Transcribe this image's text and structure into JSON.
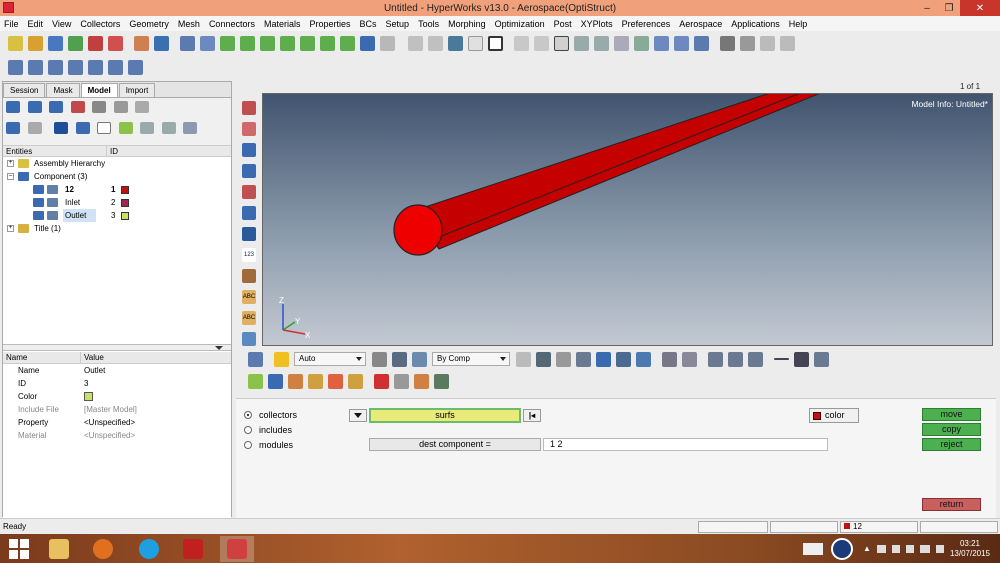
{
  "window": {
    "title": "Untitled - HyperWorks v13.0 - Aerospace(OptiStruct)",
    "minimize": "–",
    "restore": "❐",
    "close": "✕"
  },
  "menu": [
    "File",
    "Edit",
    "View",
    "Collectors",
    "Geometry",
    "Mesh",
    "Connectors",
    "Materials",
    "Properties",
    "BCs",
    "Setup",
    "Tools",
    "Morphing",
    "Optimization",
    "Post",
    "XYPlots",
    "Preferences",
    "Aerospace",
    "Applications",
    "Help"
  ],
  "sidebar": {
    "tabs": [
      "Session",
      "Mask",
      "Model",
      "Import"
    ],
    "active_tab": "Model",
    "columns": {
      "entities": "Entities",
      "id": "ID"
    },
    "tree": {
      "assembly": "Assembly Hierarchy",
      "component": "Component (3)",
      "comp1": {
        "name": "12",
        "id": "1",
        "color": "#c01010"
      },
      "comp2": {
        "name": "Inlet",
        "id": "2",
        "color": "#a0284a"
      },
      "comp3": {
        "name": "Outlet",
        "id": "3",
        "color": "#c8e06a"
      },
      "title": "Title (1)"
    },
    "props": {
      "col_name": "Name",
      "col_value": "Value",
      "rows": [
        {
          "k": "Name",
          "v": "Outlet"
        },
        {
          "k": "ID",
          "v": "3"
        },
        {
          "k": "Color",
          "v": ""
        },
        {
          "k": "Include File",
          "v": "[Master Model]"
        },
        {
          "k": "Property",
          "v": "<Unspecified>"
        },
        {
          "k": "Material",
          "v": "<Unspecified>"
        }
      ]
    }
  },
  "viewport": {
    "page_count": "1 of 1",
    "model_info": "Model Info: Untitled*",
    "axis": {
      "z": "Z",
      "y": "Y",
      "x": "X"
    },
    "pipe_color": "#c40000",
    "badge_123": "123",
    "badge_abc": "ABC"
  },
  "graphics_toolbar": {
    "auto_label": "Auto",
    "bycomp_label": "By Comp"
  },
  "panel": {
    "radio_collectors": "collectors",
    "radio_includes": "includes",
    "radio_modules": "modules",
    "selector_value": "surfs",
    "dest_button": "dest component =",
    "dest_value": "1  2",
    "color_button": "color",
    "move": "move",
    "copy": "copy",
    "reject": "reject",
    "return": "return"
  },
  "status": {
    "text": "Ready",
    "comp_value": "12"
  },
  "taskbar": {
    "clock_time": "03:21",
    "clock_date": "13/07/2015"
  }
}
